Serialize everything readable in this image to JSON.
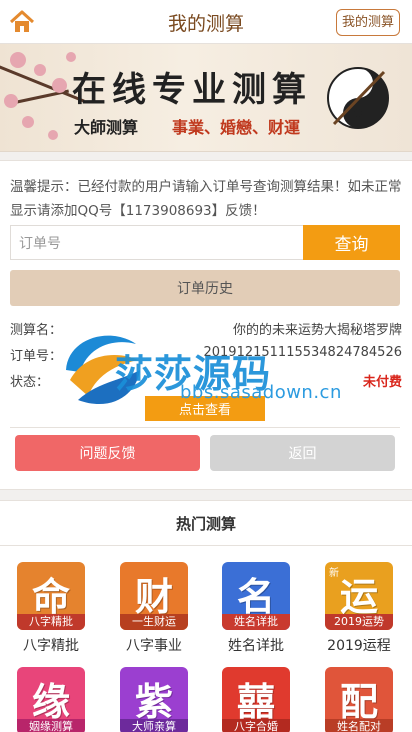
{
  "header": {
    "title": "我的测算",
    "my_button": "我的测算",
    "home_icon": "home-icon"
  },
  "banner": {
    "title": "在线专业测算",
    "subtitle_a": "大師测算",
    "subtitle_b": "事業、婚戀、财運"
  },
  "query": {
    "notice": "温馨提示：已经付款的用户请输入订单号查询测算结果！如未正常显示请添加QQ号【1173908693】反馈！",
    "order_placeholder": "订单号",
    "query_button": "查询",
    "history_button": "订单历史",
    "name_label": "测算名：",
    "name_value": "你的的未来运势大揭秘塔罗牌",
    "order_label": "订单号：",
    "order_value": "201912151115534824784526",
    "status_label": "状态：",
    "status_value": "未付费",
    "view_button": "点击查看",
    "feedback_button": "问题反馈",
    "back_button": "返回"
  },
  "watermark": {
    "name": "莎莎源码",
    "url": "bbs.sasadown.cn"
  },
  "hot": {
    "title": "热门测算",
    "items": [
      {
        "glyph": "命",
        "strip": "八字精批",
        "label": "八字精批",
        "color": "#e5832e",
        "strip_color": "#c0392b",
        "corner": ""
      },
      {
        "glyph": "财",
        "strip": "一生财运",
        "label": "八字事业",
        "color": "#e8792b",
        "strip_color": "#b7401f",
        "corner": ""
      },
      {
        "glyph": "名",
        "strip": "姓名详批",
        "label": "姓名详批",
        "color": "#3b6fd6",
        "strip_color": "#c93a2f",
        "corner": ""
      },
      {
        "glyph": "运",
        "strip": "2019运势",
        "label": "2019运程",
        "color": "#e9a01f",
        "strip_color": "#c0392b",
        "corner": "新"
      },
      {
        "glyph": "缘",
        "strip": "姻缘测算",
        "label": "",
        "color": "#e8457a",
        "strip_color": "#b8256a",
        "corner": ""
      },
      {
        "glyph": "紫",
        "strip": "大师亲算",
        "label": "",
        "color": "#9b3fd0",
        "strip_color": "#6d2a9c",
        "corner": ""
      },
      {
        "glyph": "囍",
        "strip": "八字合婚",
        "label": "",
        "color": "#e03a2e",
        "strip_color": "#b32a20",
        "corner": ""
      },
      {
        "glyph": "配",
        "strip": "姓名配对",
        "label": "",
        "color": "#e0553a",
        "strip_color": "#b93d26",
        "corner": ""
      }
    ]
  }
}
